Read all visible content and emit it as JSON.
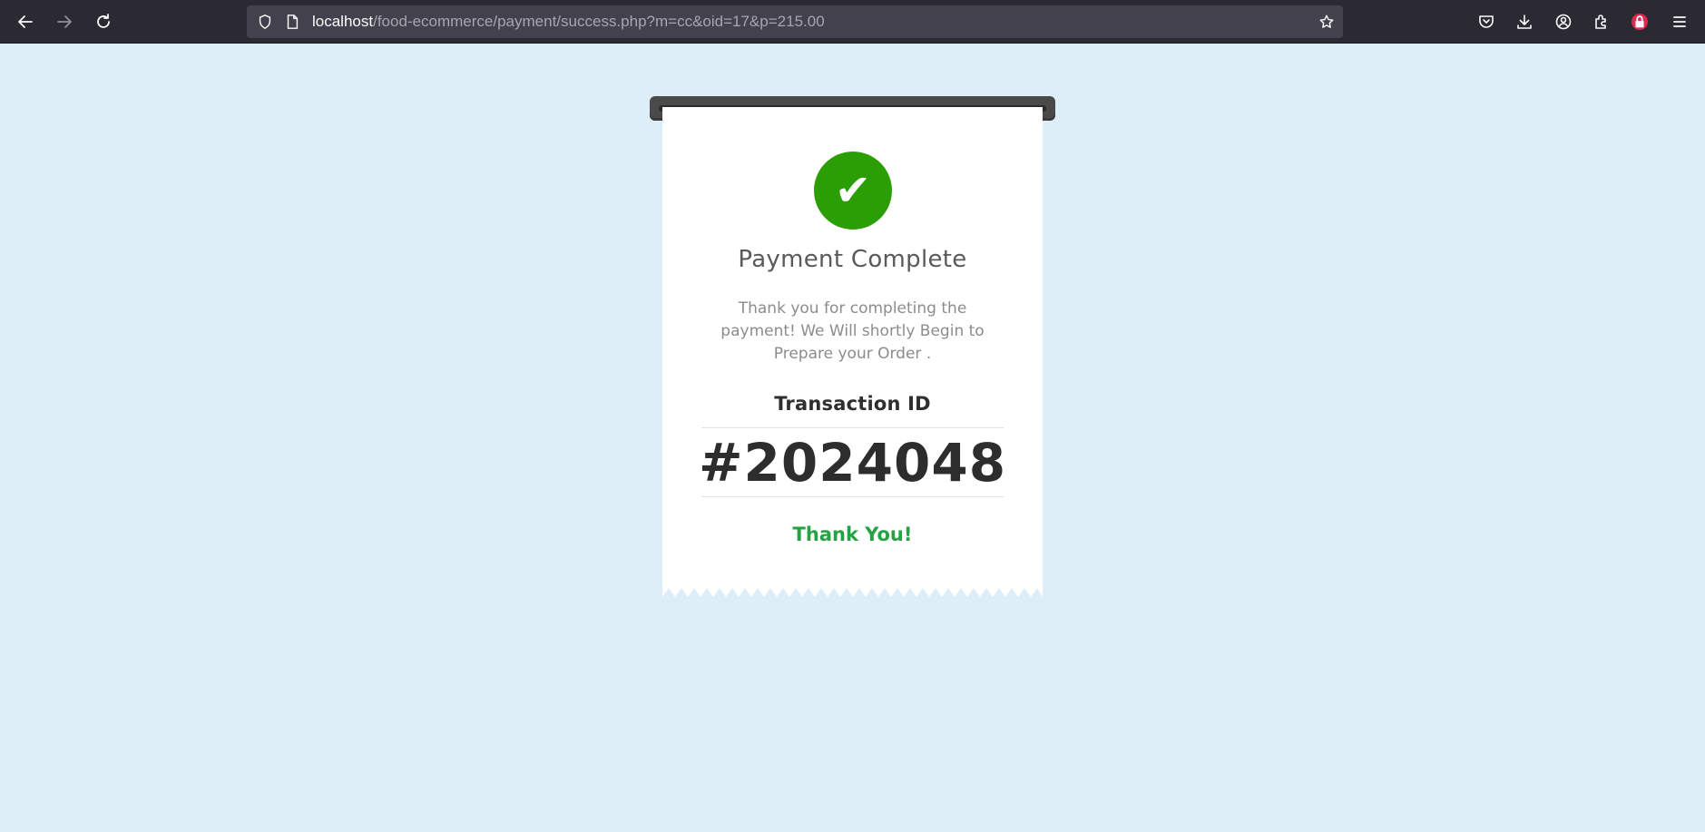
{
  "browser": {
    "url_host": "localhost",
    "url_path": "/food-ecommerce/payment/success.php?m=cc&oid=17&p=215.00",
    "icons": {
      "back": "arrow-left-icon",
      "forward": "arrow-right-icon",
      "reload": "reload-icon",
      "site_info": "shield-icon",
      "page": "page-icon",
      "bookmark": "star-icon",
      "pocket": "pocket-icon",
      "downloads": "download-icon",
      "account": "account-icon",
      "extensions": "extensions-icon",
      "addon": "lock-badge-icon",
      "menu": "hamburger-menu-icon"
    }
  },
  "receipt": {
    "title": "Payment Complete",
    "message": "Thank you for completing the payment! We Will shortly Begin to Prepare your Order .",
    "transaction_label": "Transaction ID",
    "transaction_id": "#2024048",
    "thank_you": "Thank You!",
    "check_symbol": "✔"
  },
  "colors": {
    "page_background": "#deeef9",
    "success_green": "#2c9e05",
    "thank_you_green": "#25a244",
    "toolbar": "#2b2a33"
  }
}
